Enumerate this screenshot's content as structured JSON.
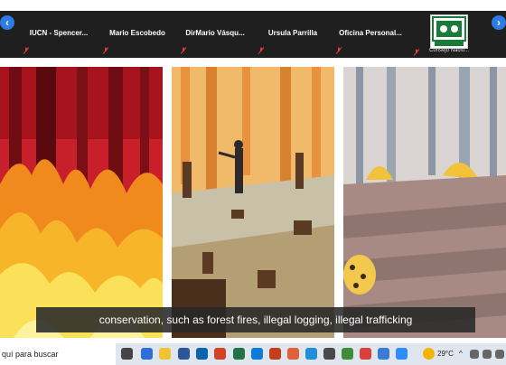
{
  "participants": [
    {
      "name": "IUCN - Spencer..."
    },
    {
      "name": "Mario Escobedo"
    },
    {
      "name": "DirMario Vásqu..."
    },
    {
      "name": "Ursula Parrilla"
    },
    {
      "name": "Oficina Personal..."
    },
    {
      "name": "Consejo Nacio..."
    }
  ],
  "nav": {
    "prev_icon": "‹",
    "next_icon": "›"
  },
  "caption": "conservation, such as forest fires, illegal logging, illegal trafficking",
  "taskbar": {
    "search_placeholder": "quí para buscar",
    "weather_temp": "29°C"
  },
  "colors": {
    "accent": "#2f7ae5",
    "strip_bg": "#1f1f1f",
    "muted_red": "#e0403a"
  }
}
